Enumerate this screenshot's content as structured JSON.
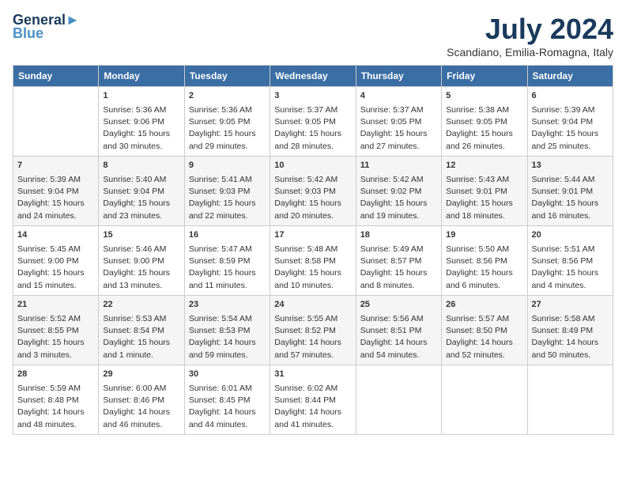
{
  "header": {
    "logo_line1": "General",
    "logo_line2": "Blue",
    "month_title": "July 2024",
    "subtitle": "Scandiano, Emilia-Romagna, Italy"
  },
  "days_of_week": [
    "Sunday",
    "Monday",
    "Tuesday",
    "Wednesday",
    "Thursday",
    "Friday",
    "Saturday"
  ],
  "weeks": [
    [
      {
        "day": "",
        "empty": true
      },
      {
        "day": "1",
        "sunrise": "5:36 AM",
        "sunset": "9:06 PM",
        "daylight": "15 hours and 30 minutes."
      },
      {
        "day": "2",
        "sunrise": "5:36 AM",
        "sunset": "9:05 PM",
        "daylight": "15 hours and 29 minutes."
      },
      {
        "day": "3",
        "sunrise": "5:37 AM",
        "sunset": "9:05 PM",
        "daylight": "15 hours and 28 minutes."
      },
      {
        "day": "4",
        "sunrise": "5:37 AM",
        "sunset": "9:05 PM",
        "daylight": "15 hours and 27 minutes."
      },
      {
        "day": "5",
        "sunrise": "5:38 AM",
        "sunset": "9:05 PM",
        "daylight": "15 hours and 26 minutes."
      },
      {
        "day": "6",
        "sunrise": "5:39 AM",
        "sunset": "9:04 PM",
        "daylight": "15 hours and 25 minutes."
      }
    ],
    [
      {
        "day": "7",
        "sunrise": "5:39 AM",
        "sunset": "9:04 PM",
        "daylight": "15 hours and 24 minutes."
      },
      {
        "day": "8",
        "sunrise": "5:40 AM",
        "sunset": "9:04 PM",
        "daylight": "15 hours and 23 minutes."
      },
      {
        "day": "9",
        "sunrise": "5:41 AM",
        "sunset": "9:03 PM",
        "daylight": "15 hours and 22 minutes."
      },
      {
        "day": "10",
        "sunrise": "5:42 AM",
        "sunset": "9:03 PM",
        "daylight": "15 hours and 20 minutes."
      },
      {
        "day": "11",
        "sunrise": "5:42 AM",
        "sunset": "9:02 PM",
        "daylight": "15 hours and 19 minutes."
      },
      {
        "day": "12",
        "sunrise": "5:43 AM",
        "sunset": "9:01 PM",
        "daylight": "15 hours and 18 minutes."
      },
      {
        "day": "13",
        "sunrise": "5:44 AM",
        "sunset": "9:01 PM",
        "daylight": "15 hours and 16 minutes."
      }
    ],
    [
      {
        "day": "14",
        "sunrise": "5:45 AM",
        "sunset": "9:00 PM",
        "daylight": "15 hours and 15 minutes."
      },
      {
        "day": "15",
        "sunrise": "5:46 AM",
        "sunset": "9:00 PM",
        "daylight": "15 hours and 13 minutes."
      },
      {
        "day": "16",
        "sunrise": "5:47 AM",
        "sunset": "8:59 PM",
        "daylight": "15 hours and 11 minutes."
      },
      {
        "day": "17",
        "sunrise": "5:48 AM",
        "sunset": "8:58 PM",
        "daylight": "15 hours and 10 minutes."
      },
      {
        "day": "18",
        "sunrise": "5:49 AM",
        "sunset": "8:57 PM",
        "daylight": "15 hours and 8 minutes."
      },
      {
        "day": "19",
        "sunrise": "5:50 AM",
        "sunset": "8:56 PM",
        "daylight": "15 hours and 6 minutes."
      },
      {
        "day": "20",
        "sunrise": "5:51 AM",
        "sunset": "8:56 PM",
        "daylight": "15 hours and 4 minutes."
      }
    ],
    [
      {
        "day": "21",
        "sunrise": "5:52 AM",
        "sunset": "8:55 PM",
        "daylight": "15 hours and 3 minutes."
      },
      {
        "day": "22",
        "sunrise": "5:53 AM",
        "sunset": "8:54 PM",
        "daylight": "15 hours and 1 minute."
      },
      {
        "day": "23",
        "sunrise": "5:54 AM",
        "sunset": "8:53 PM",
        "daylight": "14 hours and 59 minutes."
      },
      {
        "day": "24",
        "sunrise": "5:55 AM",
        "sunset": "8:52 PM",
        "daylight": "14 hours and 57 minutes."
      },
      {
        "day": "25",
        "sunrise": "5:56 AM",
        "sunset": "8:51 PM",
        "daylight": "14 hours and 54 minutes."
      },
      {
        "day": "26",
        "sunrise": "5:57 AM",
        "sunset": "8:50 PM",
        "daylight": "14 hours and 52 minutes."
      },
      {
        "day": "27",
        "sunrise": "5:58 AM",
        "sunset": "8:49 PM",
        "daylight": "14 hours and 50 minutes."
      }
    ],
    [
      {
        "day": "28",
        "sunrise": "5:59 AM",
        "sunset": "8:48 PM",
        "daylight": "14 hours and 48 minutes."
      },
      {
        "day": "29",
        "sunrise": "6:00 AM",
        "sunset": "8:46 PM",
        "daylight": "14 hours and 46 minutes."
      },
      {
        "day": "30",
        "sunrise": "6:01 AM",
        "sunset": "8:45 PM",
        "daylight": "14 hours and 44 minutes."
      },
      {
        "day": "31",
        "sunrise": "6:02 AM",
        "sunset": "8:44 PM",
        "daylight": "14 hours and 41 minutes."
      },
      {
        "day": "",
        "empty": true
      },
      {
        "day": "",
        "empty": true
      },
      {
        "day": "",
        "empty": true
      }
    ]
  ]
}
